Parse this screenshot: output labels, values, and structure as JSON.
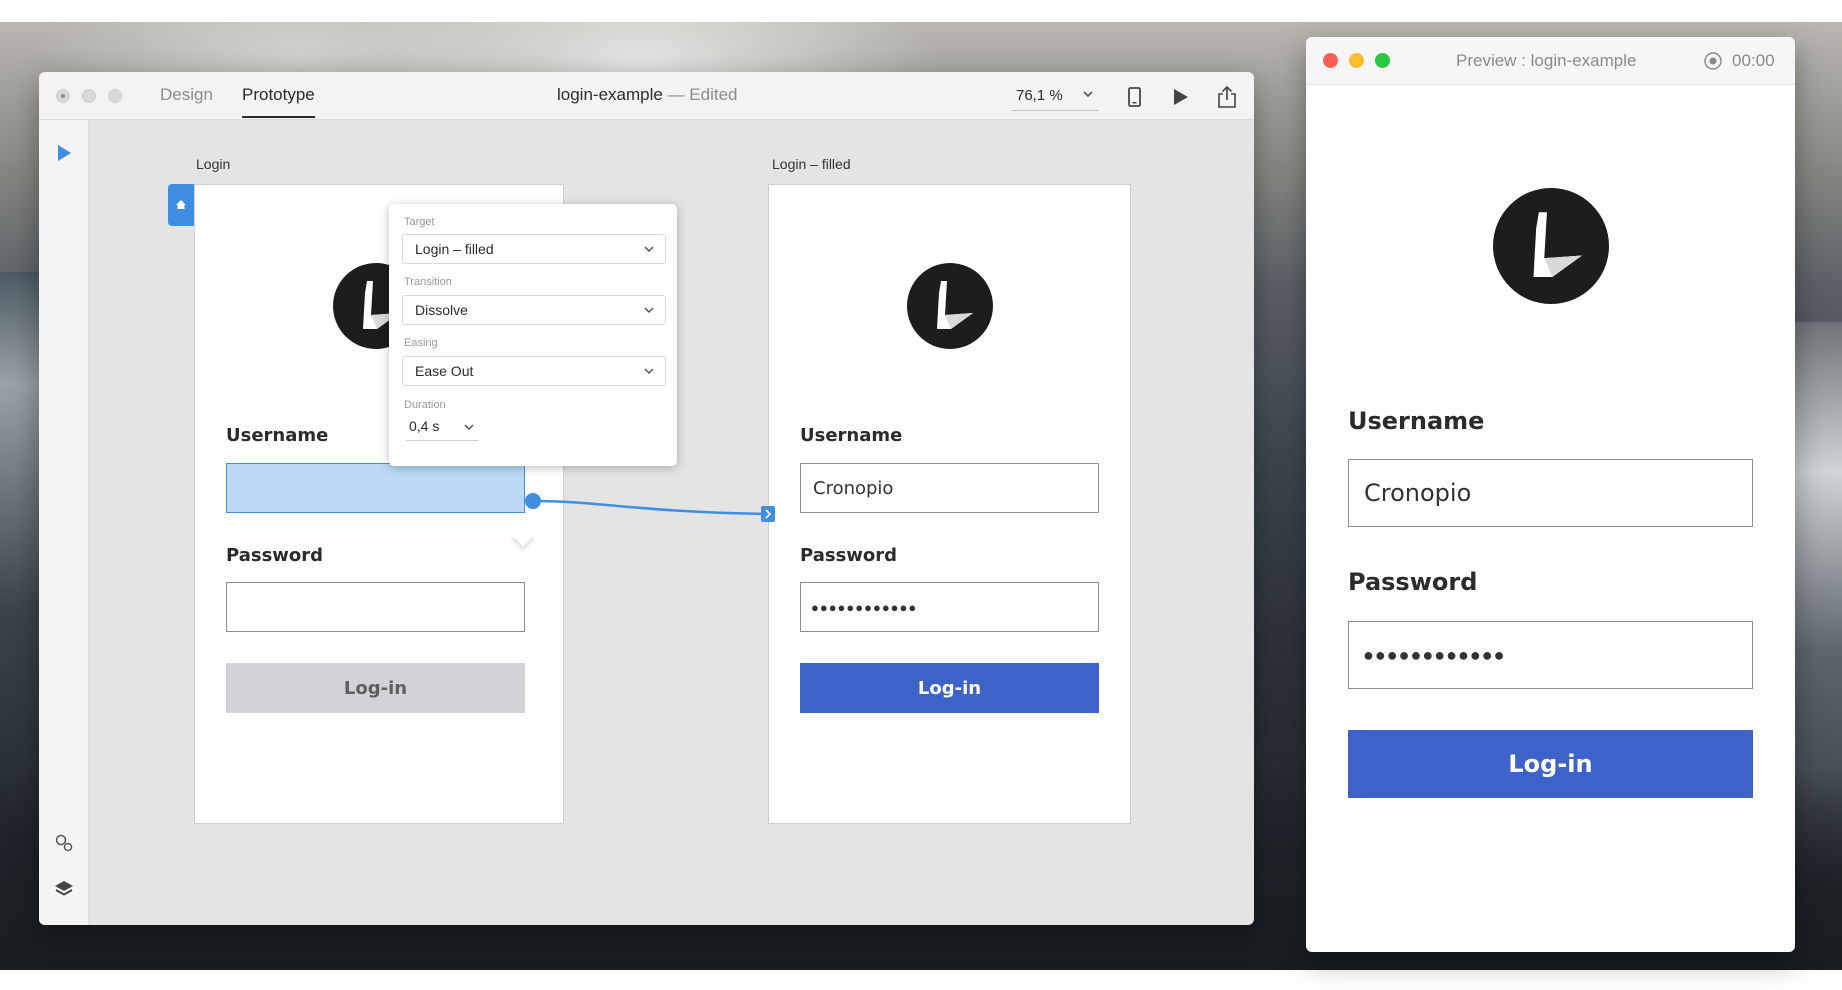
{
  "editor": {
    "tabs": {
      "design": "Design",
      "prototype": "Prototype"
    },
    "doc_name": "login-example",
    "doc_status": " — Edited",
    "zoom": "76,1 %"
  },
  "artboards": {
    "login": {
      "label": "Login",
      "username_label": "Username",
      "username_value": "",
      "password_label": "Password",
      "password_value": "",
      "button_label": "Log-in"
    },
    "login_filled": {
      "label": "Login – filled",
      "username_label": "Username",
      "username_value": "Cronopio",
      "password_label": "Password",
      "password_value": "●●●●●●●●●●●●",
      "button_label": "Log-in"
    }
  },
  "popover": {
    "target_label": "Target",
    "target_value": "Login – filled",
    "transition_label": "Transition",
    "transition_value": "Dissolve",
    "easing_label": "Easing",
    "easing_value": "Ease Out",
    "duration_label": "Duration",
    "duration_value": "0,4 s"
  },
  "preview": {
    "title": "Preview : login-example",
    "time": "00:00",
    "username_label": "Username",
    "username_value": "Cronopio",
    "password_label": "Password",
    "password_value": "●●●●●●●●●●●●",
    "button_label": "Log-in"
  },
  "colors": {
    "accent_blue": "#3d63c9",
    "wire_blue": "#3f8ee4",
    "disabled_button": "#d1d3d6",
    "selection_fill": "#bcd9f5"
  },
  "icons": [
    "select-arrow-icon",
    "assets-icon",
    "layers-icon",
    "device-icon",
    "play-icon",
    "share-icon",
    "chevron-down-icon",
    "home-icon",
    "record-icon",
    "logo-icon"
  ]
}
